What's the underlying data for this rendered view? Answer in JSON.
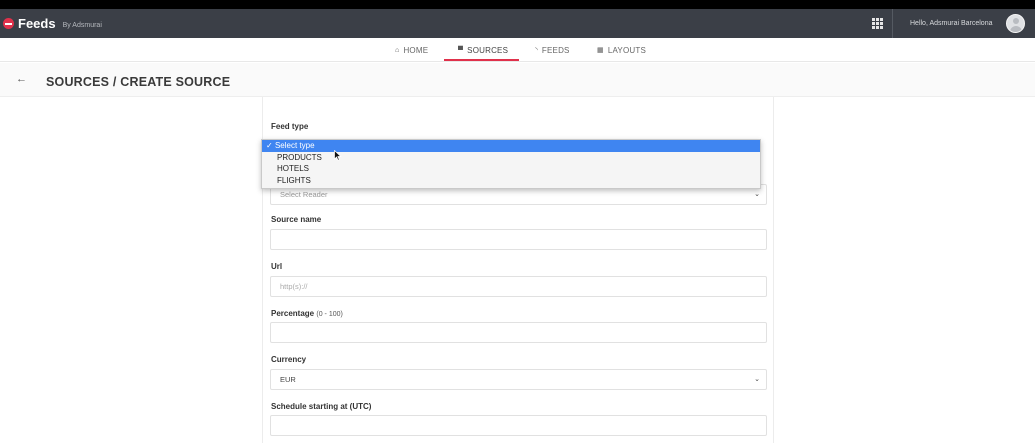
{
  "app": {
    "name": "Feeds",
    "by": "By Adsmurai"
  },
  "header": {
    "greeting": "Hello, Adsmurai Barcelona"
  },
  "nav": {
    "items": [
      {
        "label": "HOME",
        "icon": "home-icon"
      },
      {
        "label": "SOURCES",
        "icon": "cart-icon"
      },
      {
        "label": "FEEDS",
        "icon": "rss-icon"
      },
      {
        "label": "LAYOUTS",
        "icon": "grid-icon"
      }
    ],
    "active": "SOURCES"
  },
  "page": {
    "title": "SOURCES / CREATE SOURCE"
  },
  "form": {
    "feed_type": {
      "label": "Feed type"
    },
    "reader": {
      "value": "Select Reader"
    },
    "source_name": {
      "label": "Source name",
      "value": ""
    },
    "url": {
      "label": "Url",
      "placeholder": "http(s)://"
    },
    "percentage": {
      "label": "Percentage",
      "hint": "(0 - 100)",
      "value": ""
    },
    "currency": {
      "label": "Currency",
      "value": "EUR"
    },
    "schedule": {
      "label": "Schedule starting at (UTC)",
      "value": ""
    }
  },
  "dropdown": {
    "selected_mark": "✓",
    "options": [
      "Select type",
      "PRODUCTS",
      "HOTELS",
      "FLIGHTS"
    ]
  },
  "colors": {
    "accent": "#e0314b",
    "topbar": "#3b3f47",
    "select_highlight": "#3f85f1"
  }
}
